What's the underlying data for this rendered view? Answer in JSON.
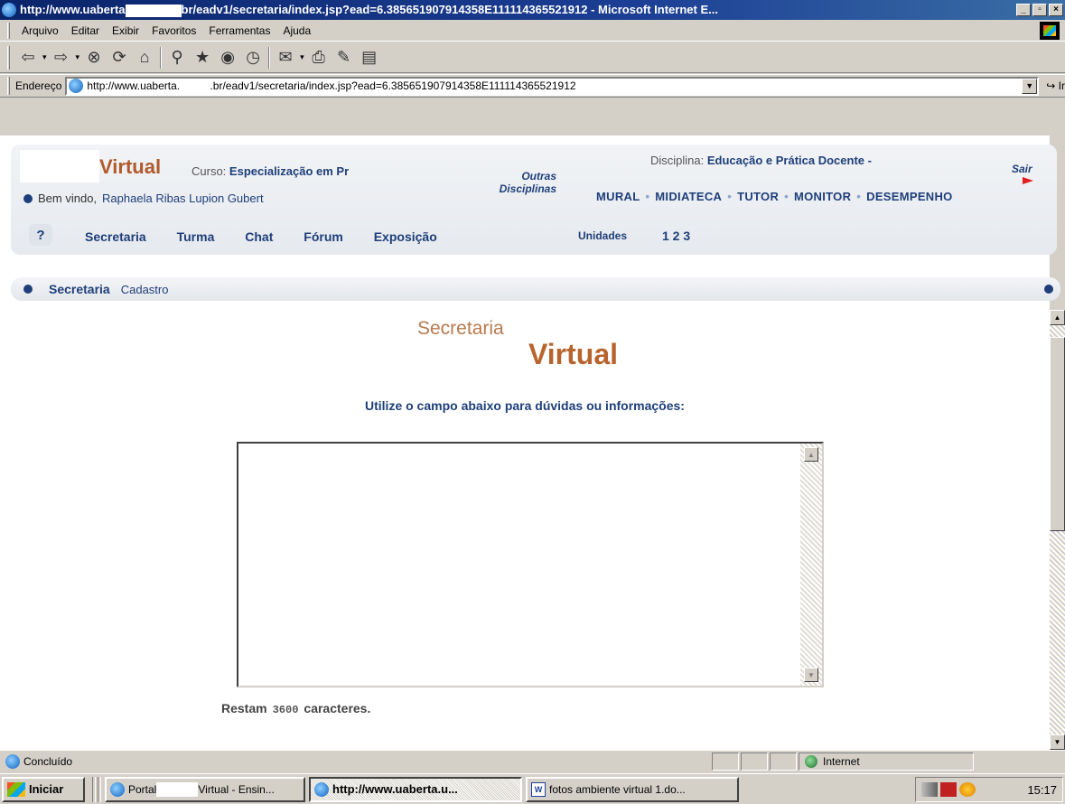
{
  "window": {
    "title_prefix": "http://www.uaberta",
    "title_suffix": "br/eadv1/secretaria/index.jsp?ead=6.385651907914358E111114365521912 - Microsoft Internet E...",
    "min": "_",
    "max": "▫",
    "close": "×"
  },
  "menu": [
    "Arquivo",
    "Editar",
    "Exibir",
    "Favoritos",
    "Ferramentas",
    "Ajuda"
  ],
  "address": {
    "label": "Endereço",
    "url": "http://www.uaberta.          .br/eadv1/secretaria/index.jsp?ead=6.385651907914358E111114365521912",
    "go": "Ir"
  },
  "header": {
    "brand": "Virtual",
    "curso_label": "Curso:",
    "curso_value": "Especialização em Pr",
    "welcome_label": "Bem vindo,",
    "user_name": "Raphaela Ribas Lupion Gubert",
    "outras": "Outras",
    "disciplinas": "Disciplinas",
    "disciplina_label": "Disciplina:",
    "disciplina_value": "Educação e Prática Docente -",
    "sair": "Sair",
    "help": "?",
    "nav_right": [
      "MURAL",
      "MIDIATECA",
      "TUTOR",
      "MONITOR",
      "DESEMPENHO"
    ],
    "tabs": [
      "Secretaria",
      "Turma",
      "Chat",
      "Fórum",
      "Exposição"
    ],
    "unidades_label": "Unidades",
    "unidades_value": "1 2 3"
  },
  "crumb": {
    "section": "Secretaria",
    "page": "Cadastro"
  },
  "content": {
    "title_small": "Secretaria",
    "title_big": "Virtual",
    "instruction": "Utilize o campo abaixo para dúvidas ou informações:",
    "textarea_value": "",
    "restam_label": "Restam",
    "restam_count": "3600",
    "restam_suffix": "caracteres."
  },
  "status": {
    "text": "Concluído",
    "zone": "Internet"
  },
  "taskbar": {
    "start": "Iniciar",
    "tasks": [
      {
        "label_a": "Portal",
        "label_b": "Virtual - Ensin...",
        "active": false
      },
      {
        "label_a": "http://www.uaberta.u...",
        "label_b": "",
        "active": true
      },
      {
        "label_a": "fotos ambiente virtual 1.do...",
        "label_b": "",
        "active": false
      }
    ],
    "time": "15:17"
  }
}
